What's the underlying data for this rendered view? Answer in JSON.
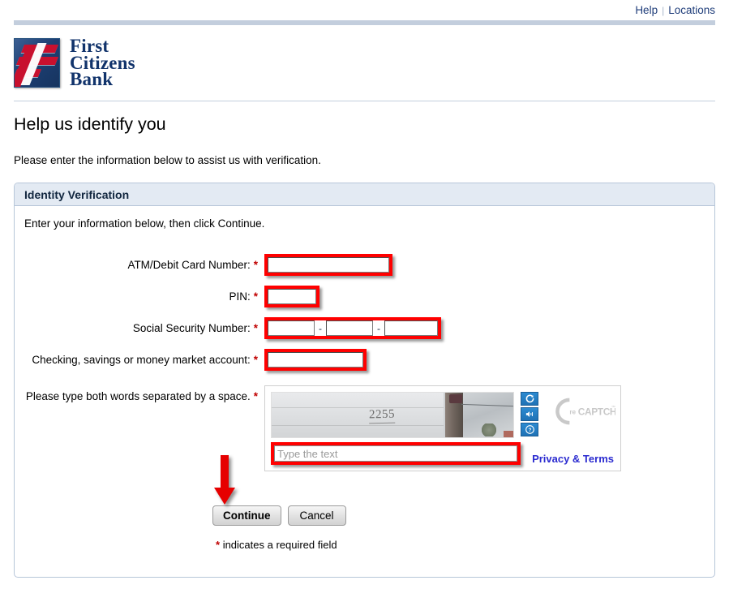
{
  "topnav": {
    "help_label": "Help",
    "separator": "|",
    "locations_label": "Locations"
  },
  "brand": {
    "line1": "First",
    "line2": "Citizens",
    "line3": "Bank",
    "logo_icon": "first-citizens-f-mark",
    "blue": "#11336b",
    "red": "#c8102e"
  },
  "page": {
    "title": "Help us identify you",
    "intro": "Please enter the information below to assist us with verification."
  },
  "panel": {
    "heading": "Identity Verification",
    "intro": "Enter your information below, then click Continue."
  },
  "form": {
    "fields": [
      {
        "label": "ATM/Debit Card Number:",
        "required_marker": "*",
        "value": "",
        "name": "atm-debit-card-number-input"
      },
      {
        "label": "PIN:",
        "required_marker": "*",
        "value": "",
        "name": "pin-input"
      },
      {
        "label": "Social Security Number:",
        "required_marker": "*",
        "value": "",
        "name": "social-security-number-input"
      },
      {
        "label": "Checking, savings or money market account:",
        "required_marker": "*",
        "value": "",
        "name": "account-number-input"
      }
    ],
    "ssn": {
      "part1": "",
      "part2": "",
      "part3": "",
      "dash": "-"
    },
    "captcha_label": "Please type both words separated by a space.",
    "captcha_required_marker": "*"
  },
  "captcha": {
    "image_text": "2255",
    "image_description": "street-view-house-number",
    "input_value": "",
    "input_placeholder": "Type the text",
    "refresh_icon": "refresh-icon",
    "audio_icon": "audio-icon",
    "help_icon": "help-icon",
    "brand_mark": "recaptcha-logo",
    "brand_text_re": "re",
    "brand_text_captcha": "CAPTCHA",
    "brand_trademark": "™",
    "privacy_link": "Privacy & Terms"
  },
  "actions": {
    "continue_label": "Continue",
    "cancel_label": "Cancel"
  },
  "footer": {
    "required_star": "*",
    "required_note": "indicates a required field"
  },
  "annotation": {
    "arrow_icon": "red-down-arrow-pointer",
    "arrow_color": "#e60000",
    "highlight_color": "#ff0000"
  }
}
